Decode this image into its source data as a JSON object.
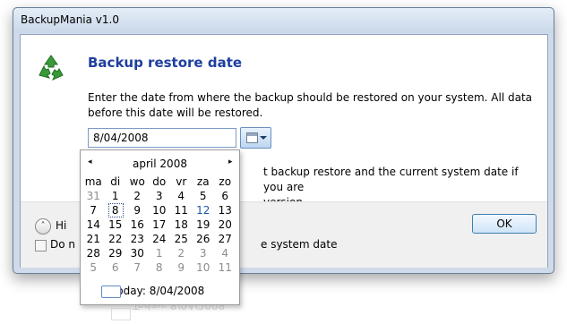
{
  "window": {
    "title": "BackupMania v1.0"
  },
  "dialog": {
    "heading": "Backup restore date",
    "instruction": "Enter the date from where the backup should be restored on your system. All data before this date will be restored.",
    "info_text": "t backup restore and the current system date if you are\n version.",
    "app_icon": "recycle-icon"
  },
  "date_picker": {
    "value": "8/04/2008",
    "dropdown_icon": "calendar-icon"
  },
  "calendar": {
    "month_label": "april 2008",
    "prev": "◂",
    "next": "▸",
    "weekdays": [
      "ma",
      "di",
      "wo",
      "do",
      "vr",
      "za",
      "zo"
    ],
    "weeks": [
      [
        {
          "d": "31",
          "o": true
        },
        {
          "d": "1"
        },
        {
          "d": "2"
        },
        {
          "d": "3"
        },
        {
          "d": "4"
        },
        {
          "d": "5"
        },
        {
          "d": "6"
        }
      ],
      [
        {
          "d": "7"
        },
        {
          "d": "8",
          "sel": true
        },
        {
          "d": "9"
        },
        {
          "d": "10"
        },
        {
          "d": "11"
        },
        {
          "d": "12",
          "today": true
        },
        {
          "d": "13"
        }
      ],
      [
        {
          "d": "14"
        },
        {
          "d": "15"
        },
        {
          "d": "16"
        },
        {
          "d": "17"
        },
        {
          "d": "18"
        },
        {
          "d": "19"
        },
        {
          "d": "20"
        }
      ],
      [
        {
          "d": "21"
        },
        {
          "d": "22"
        },
        {
          "d": "23"
        },
        {
          "d": "24"
        },
        {
          "d": "25"
        },
        {
          "d": "26"
        },
        {
          "d": "27"
        }
      ],
      [
        {
          "d": "28"
        },
        {
          "d": "29"
        },
        {
          "d": "30"
        },
        {
          "d": "1",
          "o": true
        },
        {
          "d": "2",
          "o": true
        },
        {
          "d": "3",
          "o": true
        },
        {
          "d": "4",
          "o": true
        }
      ],
      [
        {
          "d": "5",
          "o": true
        },
        {
          "d": "6",
          "o": true
        },
        {
          "d": "7",
          "o": true
        },
        {
          "d": "8",
          "o": true
        },
        {
          "d": "9",
          "o": true
        },
        {
          "d": "10",
          "o": true
        },
        {
          "d": "11",
          "o": true
        }
      ]
    ],
    "today_label": "Today: 8/04/2008"
  },
  "footer": {
    "collapse_label": "Hi",
    "dont_label": "Do n",
    "dont_suffix": "e system date",
    "ok_label": "OK"
  },
  "colors": {
    "heading": "#1e3f9e",
    "accent": "#3c7fb1"
  }
}
